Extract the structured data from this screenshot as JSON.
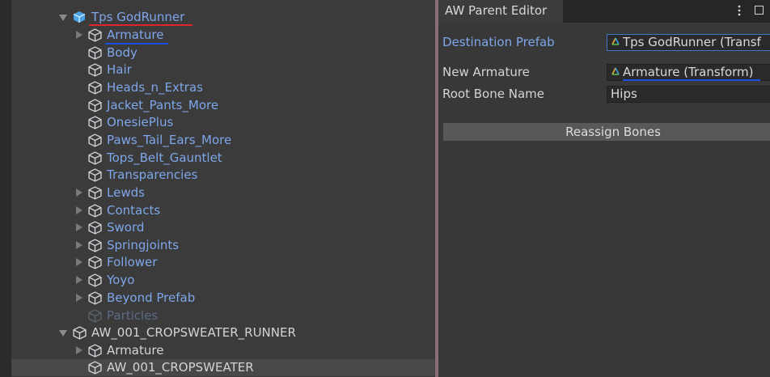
{
  "hierarchy": {
    "root": {
      "label": "Tps GodRunner"
    },
    "children": [
      {
        "label": "Armature"
      },
      {
        "label": "Body"
      },
      {
        "label": "Hair"
      },
      {
        "label": "Heads_n_Extras"
      },
      {
        "label": "Jacket_Pants_More"
      },
      {
        "label": "OnesiePlus"
      },
      {
        "label": "Paws_Tail_Ears_More"
      },
      {
        "label": "Tops_Belt_Gauntlet"
      },
      {
        "label": "Transparencies"
      },
      {
        "label": "Lewds"
      },
      {
        "label": "Contacts"
      },
      {
        "label": "Sword"
      },
      {
        "label": "Springjoints"
      },
      {
        "label": "Follower"
      },
      {
        "label": "Yoyo"
      },
      {
        "label": "Beyond Prefab"
      },
      {
        "label": "Particles"
      }
    ],
    "root2": {
      "label": "AW_001_CROPSWEATER_RUNNER"
    },
    "children2": [
      {
        "label": "Armature"
      },
      {
        "label": "AW_001_CROPSWEATER"
      }
    ]
  },
  "inspector": {
    "tab_title": "AW Parent Editor",
    "fields": {
      "destination_prefab": {
        "label": "Destination Prefab",
        "value": "Tps GodRunner (Transf"
      },
      "new_armature": {
        "label": "New Armature",
        "value": "Armature (Transform)"
      },
      "root_bone_name": {
        "label": "Root Bone Name",
        "value": "Hips"
      }
    },
    "reassign_button": "Reassign Bones"
  },
  "colors": {
    "prefab_blue": "#7ea6ea",
    "annotation_red": "#e0242b",
    "annotation_blue": "#1d4fe0",
    "focus_border": "#3a78c8"
  }
}
